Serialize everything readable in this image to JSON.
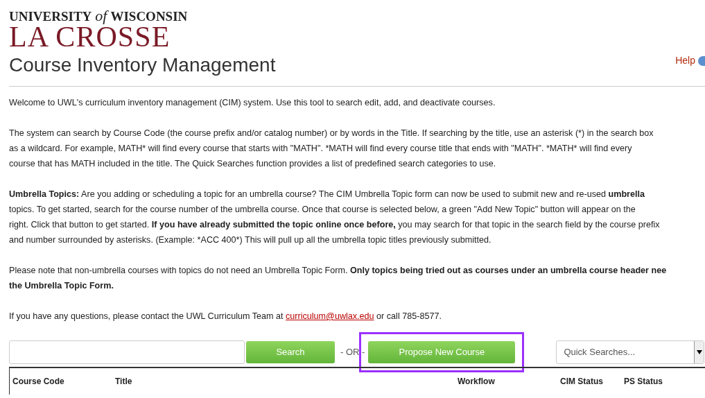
{
  "logo": {
    "line_1_start": "UNIVERSITY",
    "line_1_of": "of",
    "line_1_end": "WISCONSIN",
    "line_2": "LA CROSSE"
  },
  "title": "Course Inventory Management",
  "help": {
    "label": "Help"
  },
  "paragraphs": [
    [
      {
        "text": "Welcome to UWL's curriculum inventory management (CIM) system. Use this tool to search edit, add, and deactivate courses.",
        "bold": false
      }
    ],
    [
      {
        "text": "The system can search by Course Code (the course prefix and/or catalog number) or by words in the Title. If searching by the title, use an asterisk (*) in the search box\nas a wildcard. For example, MATH* will find every course that starts with \"MATH\". *MATH will find every course title that ends with \"MATH\". *MATH* will find every\ncourse that has MATH included in the title. The Quick Searches function provides a list of predefined search categories to use.",
        "bold": false
      }
    ],
    [
      {
        "text": "Umbrella Topics:",
        "bold": true
      },
      {
        "text": " Are you adding or scheduling a topic for an umbrella course? The CIM Umbrella Topic form can now be used to submit new and re-used ",
        "bold": false
      },
      {
        "text": "umbrella",
        "bold": true
      },
      {
        "text": "\ntopics. To get started, search for the course number of the umbrella course. Once that course is selected below, a green \"Add New Topic\" button will appear on the\nright. Click that button to get started. ",
        "bold": false
      },
      {
        "text": "If you have already submitted the topic online once before,",
        "bold": true
      },
      {
        "text": " you may search for that topic in the search field by the course prefix\nand number surrounded by asterisks. (Example: *ACC 400*) This will pull up all the umbrella topic titles previously submitted.",
        "bold": false
      }
    ],
    [
      {
        "text": "Please note that non-umbrella courses with topics do not need an Umbrella Topic Form. ",
        "bold": false
      },
      {
        "text": "Only topics being tried out as courses under an umbrella course header nee\nthe Umbrella Topic Form.",
        "bold": true
      }
    ]
  ],
  "contact": {
    "before": "If you have any questions, please contact the UWL Curriculum Team at",
    "link": "curriculum@uwlax.edu",
    "after": "or call 785-8577."
  },
  "search": {
    "button": "Search",
    "or": "- OR -",
    "propose": "Propose New Course",
    "propose_highlighted": true,
    "quick_searches": "Quick Searches..."
  },
  "table": {
    "columns": [
      "Course Code",
      "Title",
      "Workflow",
      "CIM Status",
      "PS Status"
    ]
  }
}
